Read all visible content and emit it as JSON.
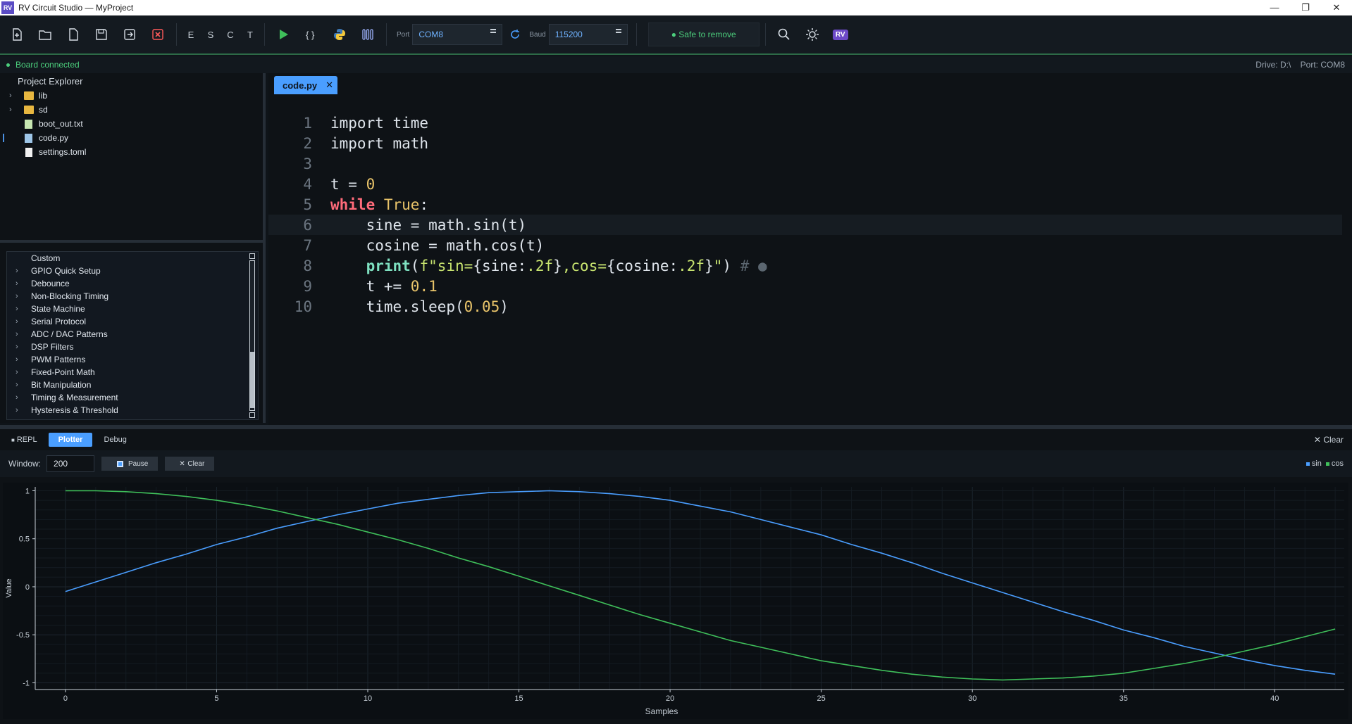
{
  "window": {
    "title": "RV Circuit Studio — MyProject",
    "icon_text": "RV",
    "controls": [
      "—",
      "❐",
      "✕"
    ]
  },
  "toolbar": {
    "letters": [
      "E",
      "S",
      "C",
      "T"
    ],
    "port_label": "Port",
    "port_value": "COM8",
    "baud_label": "Baud",
    "baud_value": "115200",
    "safe_label": "● Safe to remove",
    "badge": "RV"
  },
  "status": {
    "connected": "Board connected",
    "drive": "Drive: D:\\",
    "port": "Port: COM8"
  },
  "explorer": {
    "title": "Project Explorer",
    "items": [
      {
        "name": "lib",
        "type": "folder"
      },
      {
        "name": "sd",
        "type": "folder"
      },
      {
        "name": "boot_out.txt",
        "type": "txt"
      },
      {
        "name": "code.py",
        "type": "py"
      },
      {
        "name": "settings.toml",
        "type": "file"
      }
    ]
  },
  "snippets": {
    "items": [
      "Custom",
      "GPIO Quick Setup",
      "Debounce",
      "Non-Blocking Timing",
      "State Machine",
      "Serial Protocol",
      "ADC / DAC Patterns",
      "DSP Filters",
      "PWM Patterns",
      "Fixed-Point Math",
      "Bit Manipulation",
      "Timing & Measurement",
      "Hysteresis & Threshold"
    ]
  },
  "editor": {
    "tab": "code.py",
    "tab_close": "✕",
    "line_numbers": [
      "1",
      "2",
      "3",
      "4",
      "5",
      "6",
      "7",
      "8",
      "9",
      "10"
    ]
  },
  "bottom": {
    "tabs": [
      "REPL",
      "Plotter",
      "Debug"
    ],
    "active_tab": "Plotter",
    "clear_label": "Clear",
    "window_label": "Window:",
    "window_value": "200",
    "pause_label": "Pause",
    "clear_btn_label": "Clear",
    "legend": [
      {
        "name": "sin",
        "color": "#4a9eff"
      },
      {
        "name": "cos",
        "color": "#3fbf5a"
      }
    ]
  },
  "chart_data": {
    "type": "line",
    "xlabel": "Samples",
    "ylabel": "Value",
    "xlim": [
      -1,
      42.3
    ],
    "ylim": [
      -1.07,
      1.04
    ],
    "xticks": [
      0,
      5,
      10,
      15,
      20,
      25,
      30,
      35,
      40
    ],
    "yticks": [
      1,
      0.5,
      0,
      -0.5,
      -1
    ],
    "series": [
      {
        "name": "sin",
        "color": "#4a9eff",
        "x": [
          0,
          1,
          2,
          3,
          4,
          5,
          6,
          7,
          8,
          9,
          10,
          11,
          12,
          13,
          14,
          15,
          16,
          17,
          18,
          19,
          20,
          21,
          22,
          23,
          24,
          25,
          26,
          27,
          28,
          29,
          30,
          31,
          32,
          33,
          34,
          35,
          36,
          37,
          38,
          39,
          40,
          41,
          42
        ],
        "values": [
          -0.05,
          0.05,
          0.15,
          0.25,
          0.34,
          0.44,
          0.52,
          0.61,
          0.68,
          0.75,
          0.81,
          0.87,
          0.91,
          0.95,
          0.98,
          0.99,
          1.0,
          0.99,
          0.97,
          0.94,
          0.9,
          0.84,
          0.78,
          0.7,
          0.62,
          0.54,
          0.44,
          0.35,
          0.25,
          0.14,
          0.04,
          -0.06,
          -0.16,
          -0.26,
          -0.35,
          -0.45,
          -0.53,
          -0.62,
          -0.69,
          -0.76,
          -0.82,
          -0.87,
          -0.91
        ]
      },
      {
        "name": "cos",
        "color": "#3fbf5a",
        "x": [
          0,
          1,
          2,
          3,
          4,
          5,
          6,
          7,
          8,
          9,
          10,
          11,
          12,
          13,
          14,
          15,
          16,
          17,
          18,
          19,
          20,
          21,
          22,
          23,
          24,
          25,
          26,
          27,
          28,
          29,
          30,
          31,
          32,
          33,
          34,
          35,
          36,
          37,
          38,
          39,
          40,
          41,
          42
        ],
        "values": [
          1.0,
          1.0,
          0.99,
          0.97,
          0.94,
          0.9,
          0.85,
          0.79,
          0.72,
          0.65,
          0.57,
          0.49,
          0.4,
          0.3,
          0.21,
          0.11,
          0.01,
          -0.09,
          -0.19,
          -0.29,
          -0.38,
          -0.47,
          -0.56,
          -0.63,
          -0.7,
          -0.77,
          -0.82,
          -0.87,
          -0.91,
          -0.94,
          -0.96,
          -0.97,
          -0.96,
          -0.95,
          -0.93,
          -0.9,
          -0.85,
          -0.8,
          -0.74,
          -0.67,
          -0.6,
          -0.52,
          -0.44
        ]
      }
    ],
    "grid": true
  }
}
